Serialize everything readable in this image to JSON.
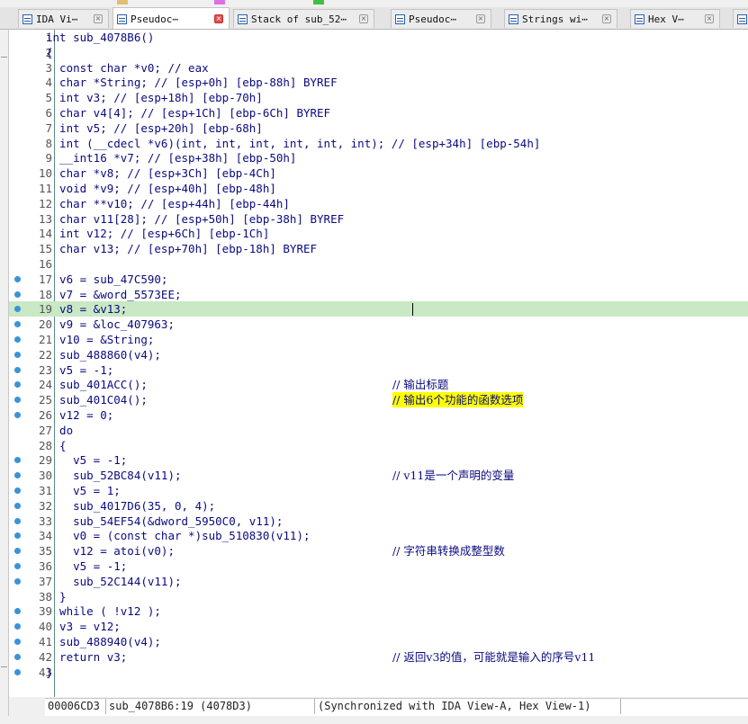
{
  "tabs": [
    {
      "label": "IDA Vi⋯",
      "active": false
    },
    {
      "label": "Pseudoc⋯",
      "active": true
    },
    {
      "label": "Stack of sub_52⋯",
      "active": false
    },
    {
      "label": "Pseudoc⋯",
      "active": false
    },
    {
      "label": "Strings wi⋯",
      "active": false
    },
    {
      "label": "Hex V⋯",
      "active": false
    },
    {
      "label": "",
      "active": false
    }
  ],
  "editor": {
    "highlighted_line": 19,
    "lines": [
      {
        "n": "1",
        "code": "int sub_4078B6()",
        "comment": "",
        "dot": false
      },
      {
        "n": "2",
        "code": "{",
        "comment": "",
        "dot": false
      },
      {
        "n": "3",
        "code": "  const char *v0; // eax",
        "comment": "",
        "dot": false
      },
      {
        "n": "4",
        "code": "  char *String; // [esp+0h] [ebp-88h] BYREF",
        "comment": "",
        "dot": false
      },
      {
        "n": "5",
        "code": "  int v3; // [esp+18h] [ebp-70h]",
        "comment": "",
        "dot": false
      },
      {
        "n": "6",
        "code": "  char v4[4]; // [esp+1Ch] [ebp-6Ch] BYREF",
        "comment": "",
        "dot": false
      },
      {
        "n": "7",
        "code": "  int v5; // [esp+20h] [ebp-68h]",
        "comment": "",
        "dot": false
      },
      {
        "n": "8",
        "code": "  int (__cdecl *v6)(int, int, int, int, int, int); // [esp+34h] [ebp-54h]",
        "comment": "",
        "dot": false
      },
      {
        "n": "9",
        "code": "  __int16 *v7; // [esp+38h] [ebp-50h]",
        "comment": "",
        "dot": false
      },
      {
        "n": "10",
        "code": "  char *v8; // [esp+3Ch] [ebp-4Ch]",
        "comment": "",
        "dot": false
      },
      {
        "n": "11",
        "code": "  void *v9; // [esp+40h] [ebp-48h]",
        "comment": "",
        "dot": false
      },
      {
        "n": "12",
        "code": "  char **v10; // [esp+44h] [ebp-44h]",
        "comment": "",
        "dot": false
      },
      {
        "n": "13",
        "code": "  char v11[28]; // [esp+50h] [ebp-38h] BYREF",
        "comment": "",
        "dot": false
      },
      {
        "n": "14",
        "code": "  int v12; // [esp+6Ch] [ebp-1Ch]",
        "comment": "",
        "dot": false
      },
      {
        "n": "15",
        "code": "  char v13; // [esp+70h] [ebp-18h] BYREF",
        "comment": "",
        "dot": false
      },
      {
        "n": "16",
        "code": "",
        "comment": "",
        "dot": false
      },
      {
        "n": "17",
        "code": "  v6 = sub_47C590;",
        "comment": "",
        "dot": true
      },
      {
        "n": "18",
        "code": "  v7 = &word_5573EE;",
        "comment": "",
        "dot": true
      },
      {
        "n": "19",
        "code": "  v8 = &v13;",
        "comment": "",
        "dot": true
      },
      {
        "n": "20",
        "code": "  v9 = &loc_407963;",
        "comment": "",
        "dot": true
      },
      {
        "n": "21",
        "code": "  v10 = &String;",
        "comment": "",
        "dot": true
      },
      {
        "n": "22",
        "code": "  sub_488860(v4);",
        "comment": "",
        "dot": true
      },
      {
        "n": "23",
        "code": "  v5 = -1;",
        "comment": "",
        "dot": true
      },
      {
        "n": "24",
        "code": "  sub_401ACC();",
        "comment": "// 输出标题",
        "dot": true
      },
      {
        "n": "25",
        "code": "  sub_401C04();",
        "comment": "// 输出6个功能的函数选项",
        "dot": true
      },
      {
        "n": "26",
        "code": "  v12 = 0;",
        "comment": "",
        "dot": true
      },
      {
        "n": "27",
        "code": "  do",
        "comment": "",
        "dot": false
      },
      {
        "n": "28",
        "code": "  {",
        "comment": "",
        "dot": false
      },
      {
        "n": "29",
        "code": "    v5 = -1;",
        "comment": "",
        "dot": true
      },
      {
        "n": "30",
        "code": "    sub_52BC84(v11);",
        "comment": "// v11是一个声明的变量",
        "dot": true
      },
      {
        "n": "31",
        "code": "    v5 = 1;",
        "comment": "",
        "dot": true
      },
      {
        "n": "32",
        "code": "    sub_4017D6(35, 0, 4);",
        "comment": "",
        "dot": true
      },
      {
        "n": "33",
        "code": "    sub_54EF54(&dword_5950C0, v11);",
        "comment": "",
        "dot": true
      },
      {
        "n": "34",
        "code": "    v0 = (const char *)sub_510830(v11);",
        "comment": "",
        "dot": true
      },
      {
        "n": "35",
        "code": "    v12 = atoi(v0);",
        "comment": "// 字符串转换成整型数",
        "dot": true
      },
      {
        "n": "36",
        "code": "    v5 = -1;",
        "comment": "",
        "dot": true
      },
      {
        "n": "37",
        "code": "    sub_52C144(v11);",
        "comment": "",
        "dot": true
      },
      {
        "n": "38",
        "code": "  }",
        "comment": "",
        "dot": false
      },
      {
        "n": "39",
        "code": "  while ( !v12 );",
        "comment": "",
        "dot": true
      },
      {
        "n": "40",
        "code": "  v3 = v12;",
        "comment": "",
        "dot": true
      },
      {
        "n": "41",
        "code": "  sub_488940(v4);",
        "comment": "",
        "dot": true
      },
      {
        "n": "42",
        "code": "  return v3;",
        "comment": "// 返回v3的值，可能就是输入的序号v11",
        "dot": true
      },
      {
        "n": "43",
        "code": "}",
        "comment": "",
        "dot": true
      }
    ]
  },
  "statusbar": {
    "address": "00006CD3",
    "location": "sub_4078B6:19 (4078D3)",
    "sync": "(Synchronized with IDA View-A, Hex View-1)"
  },
  "colors": {
    "highlight": "#c9e8c4",
    "breakpoint_dot": "#3a93d8",
    "code_text": "#0a0a80",
    "comment_highlight": "#ffff00"
  }
}
